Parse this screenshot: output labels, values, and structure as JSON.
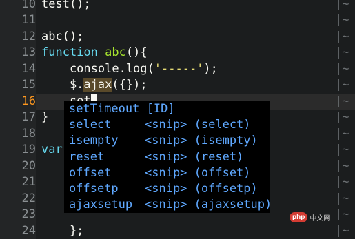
{
  "editor": {
    "lines": [
      {
        "num": "10",
        "text": "test();",
        "mark": "|~"
      },
      {
        "num": "11",
        "text": "",
        "mark": "|~"
      },
      {
        "num": "12",
        "text": "abc();",
        "mark": "|~"
      },
      {
        "num": "13",
        "kw": "function",
        "fn": "abc",
        "rest": "(){",
        "mark": "|~"
      },
      {
        "num": "14",
        "pre": "    console.log(",
        "str": "'-----'",
        "post": ");",
        "mark": "|~"
      },
      {
        "num": "15",
        "pre": "    $.",
        "hl": "ajax",
        "post": "({});",
        "mark": "|~"
      },
      {
        "num": "16",
        "text": "    set",
        "mark": "|~",
        "current": true
      },
      {
        "num": "17",
        "text": "}",
        "mark": "|~"
      },
      {
        "num": "18",
        "text": "",
        "mark": "|~"
      },
      {
        "num": "19",
        "kw": "var",
        "mark": "|~"
      },
      {
        "num": "20",
        "text": "",
        "mark": "|~"
      },
      {
        "num": "21",
        "text": "",
        "mark": "|~"
      },
      {
        "num": "22",
        "text": "",
        "mark": "|~"
      },
      {
        "num": "23",
        "text": "",
        "mark": "|~"
      },
      {
        "num": "24",
        "text": "    };",
        "mark": "|~"
      }
    ]
  },
  "completion": {
    "items": [
      {
        "word": "setTimeout",
        "menu": "[ID]"
      },
      {
        "word": "select",
        "menu": "<snip> (select)"
      },
      {
        "word": "isempty",
        "menu": "<snip> (isempty)"
      },
      {
        "word": "reset",
        "menu": "<snip> (reset)"
      },
      {
        "word": "offset",
        "menu": "<snip> (offset)"
      },
      {
        "word": "offsetp",
        "menu": "<snip> (offsetp)"
      },
      {
        "word": "ajaxsetup",
        "menu": "<snip> (ajaxsetup)"
      }
    ]
  },
  "watermark": {
    "badge": "php",
    "text": "中文网"
  }
}
